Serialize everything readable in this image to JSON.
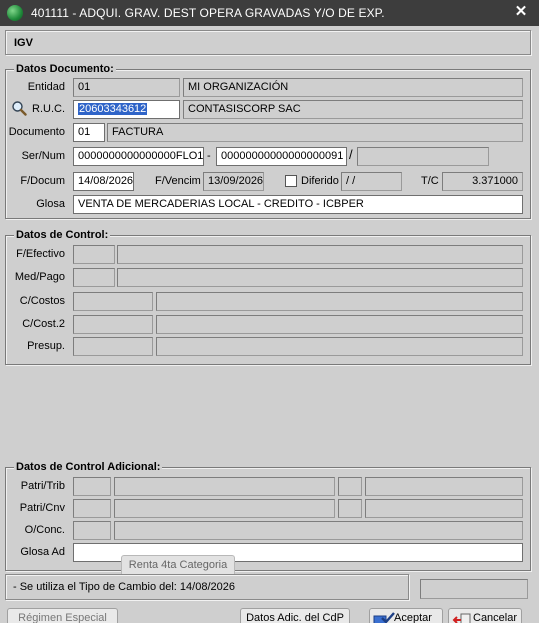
{
  "window": {
    "title": "401111 - ADQUI. GRAV. DEST OPERA GRAVADAS Y/O DE EXP.",
    "close_glyph": "✕"
  },
  "header": {
    "tax_label": "IGV"
  },
  "datos_documento": {
    "title": "Datos Documento:",
    "entidad": {
      "label": "Entidad",
      "code": "01",
      "name": "MI ORGANIZACIÓN"
    },
    "ruc": {
      "label": "R.U.C.",
      "value": "20603343612",
      "name": "CONTASISCORP SAC",
      "icon": "magnifier-icon"
    },
    "documento": {
      "label": "Documento",
      "code": "01",
      "name": "FACTURA"
    },
    "sernum": {
      "label": "Ser/Num",
      "serie": "0000000000000000FLO1",
      "dash": "-",
      "numero": "00000000000000000091",
      "slash": "/",
      "extra": ""
    },
    "fdocum": {
      "label": "F/Docum",
      "value": "14/08/2026"
    },
    "fvencim": {
      "label": "F/Vencim",
      "value": "13/09/2026"
    },
    "diferido": {
      "label": "Diferido",
      "checked": false,
      "value": " /  /"
    },
    "tc": {
      "label": "T/C",
      "value": "3.371000"
    },
    "glosa": {
      "label": "Glosa",
      "value": "VENTA DE MERCADERIAS LOCAL - CREDITO - ICBPER"
    }
  },
  "datos_control": {
    "title": "Datos de Control:",
    "rows": [
      {
        "label": "F/Efectivo"
      },
      {
        "label": "Med/Pago"
      },
      {
        "label": "C/Costos"
      },
      {
        "label": "C/Cost.2"
      },
      {
        "label": "Presup."
      }
    ]
  },
  "datos_control_adicional": {
    "title": "Datos de Control Adicional:",
    "rows": [
      {
        "label": "Patri/Trib"
      },
      {
        "label": "Patri/Cnv"
      },
      {
        "label": "O/Conc."
      },
      {
        "label": "Glosa Ad"
      }
    ]
  },
  "tabs": {
    "renta": "Renta 4ta Categoria"
  },
  "status": {
    "message": "- Se utiliza el Tipo de Cambio del: 14/08/2026"
  },
  "buttons": {
    "regimen": "Régimen Especial",
    "datos_adic": "Datos Adic. del CdP",
    "aceptar": "Aceptar",
    "cancelar": "Cancelar"
  }
}
